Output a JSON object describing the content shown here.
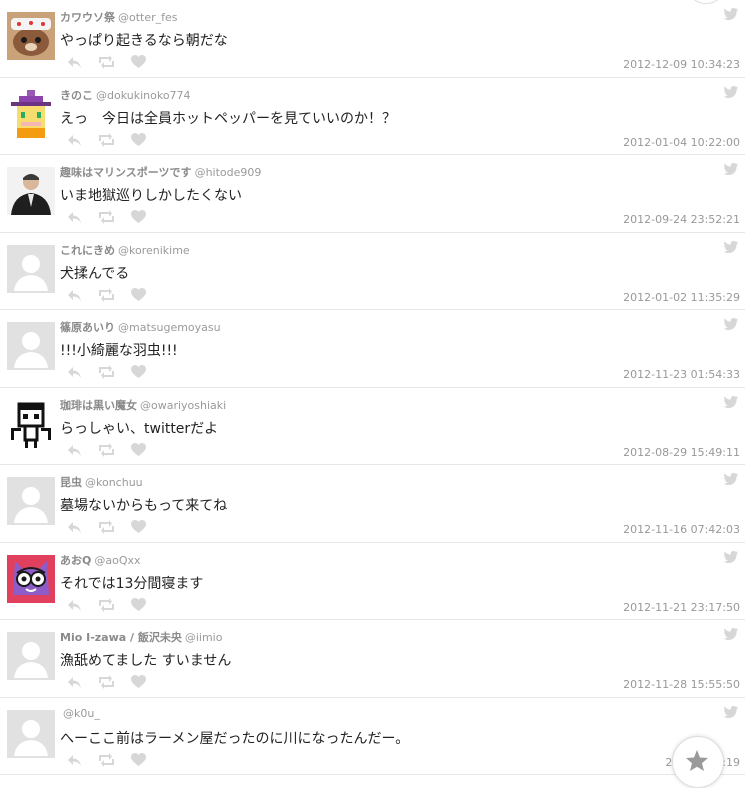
{
  "colors": {
    "icon": "#d7d7d7",
    "muted_text": "#9a9a9a",
    "divider": "#e6e6e6"
  },
  "tweets": [
    {
      "name": "カワウソ祭",
      "handle": "@otter_fes",
      "text": "やっぱり起きるなら朝だな",
      "time": "2012-12-09 10:34:23"
    },
    {
      "name": "きのこ",
      "handle": "@dokukinoko774",
      "text": "えっ　今日は全員ホットペッパーを見ていいのか！？",
      "time": "2012-01-04 10:22:00"
    },
    {
      "name": "趣味はマリンスポーツです",
      "handle": "@hitode909",
      "text": "いま地獄巡りしかしたくない",
      "time": "2012-09-24 23:52:21"
    },
    {
      "name": "これにきめ",
      "handle": "@korenikime",
      "text": "犬揉んでる",
      "time": "2012-01-02 11:35:29"
    },
    {
      "name": "篠原あいり",
      "handle": "@matsugemoyasu",
      "text": "!!!小綺麗な羽虫!!!",
      "time": "2012-11-23 01:54:33"
    },
    {
      "name": "珈琲は黒い魔女",
      "handle": "@owariyoshiaki",
      "text": "らっしゃい、twitterだよ",
      "time": "2012-08-29 15:49:11"
    },
    {
      "name": "昆虫",
      "handle": "@konchuu",
      "text": "墓場ないからもって来てね",
      "time": "2012-11-16 07:42:03"
    },
    {
      "name": "あおQ",
      "handle": "@aoQxx",
      "text": "それでは13分間寝ます",
      "time": "2012-11-21 23:17:50"
    },
    {
      "name": "Mio I-zawa / 飯沢未央",
      "handle": "@iimio",
      "text": "漁舐めてました すいません",
      "time": "2012-11-28 15:55:50"
    },
    {
      "name": "",
      "handle": "@k0u_",
      "text": "へーここ前はラーメン屋だったのに川になったんだー。",
      "time": "2012-1…7:19"
    }
  ]
}
